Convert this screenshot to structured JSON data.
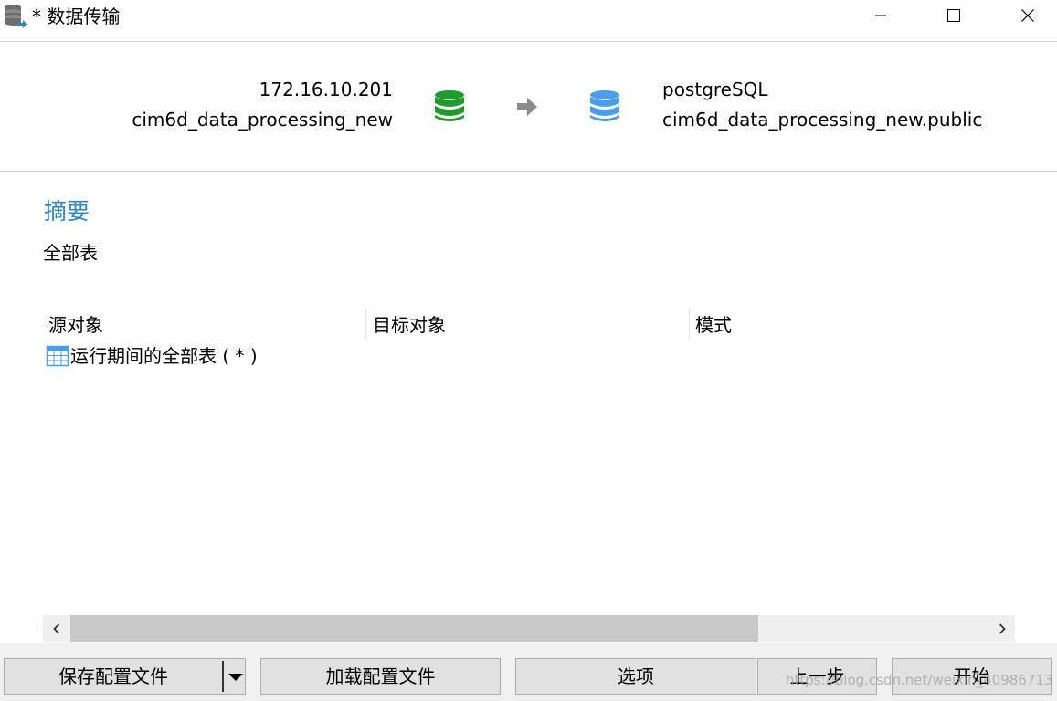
{
  "window": {
    "title": "* 数据传输",
    "minimize_glyph": "—",
    "maximize_glyph": "☐",
    "close_glyph": "✕"
  },
  "header": {
    "source": {
      "host": "172.16.10.201",
      "database": "cim6d_data_processing_new",
      "icon": "database-icon",
      "color": "#1f9b2b"
    },
    "arrow_icon": "arrow-right-icon",
    "target": {
      "host": "postgreSQL",
      "database": "cim6d_data_processing_new.public",
      "icon": "database-icon",
      "color": "#4c9cee"
    }
  },
  "summary": {
    "title": "摘要",
    "subtitle": "全部表",
    "title_color": "#2d86c8"
  },
  "table": {
    "columns": [
      "源对象",
      "目标对象",
      "模式"
    ],
    "rows": [
      {
        "source": "运行期间的全部表 ( * )",
        "target": "",
        "mode": "",
        "icon": "table-icon"
      }
    ]
  },
  "footer": {
    "save_label": "保存配置文件",
    "load_label": "加载配置文件",
    "options_label": "选项",
    "prev_label": "上一步",
    "start_label": "开始"
  },
  "watermark": "https://blog.csdn.net/weixin_40986713"
}
